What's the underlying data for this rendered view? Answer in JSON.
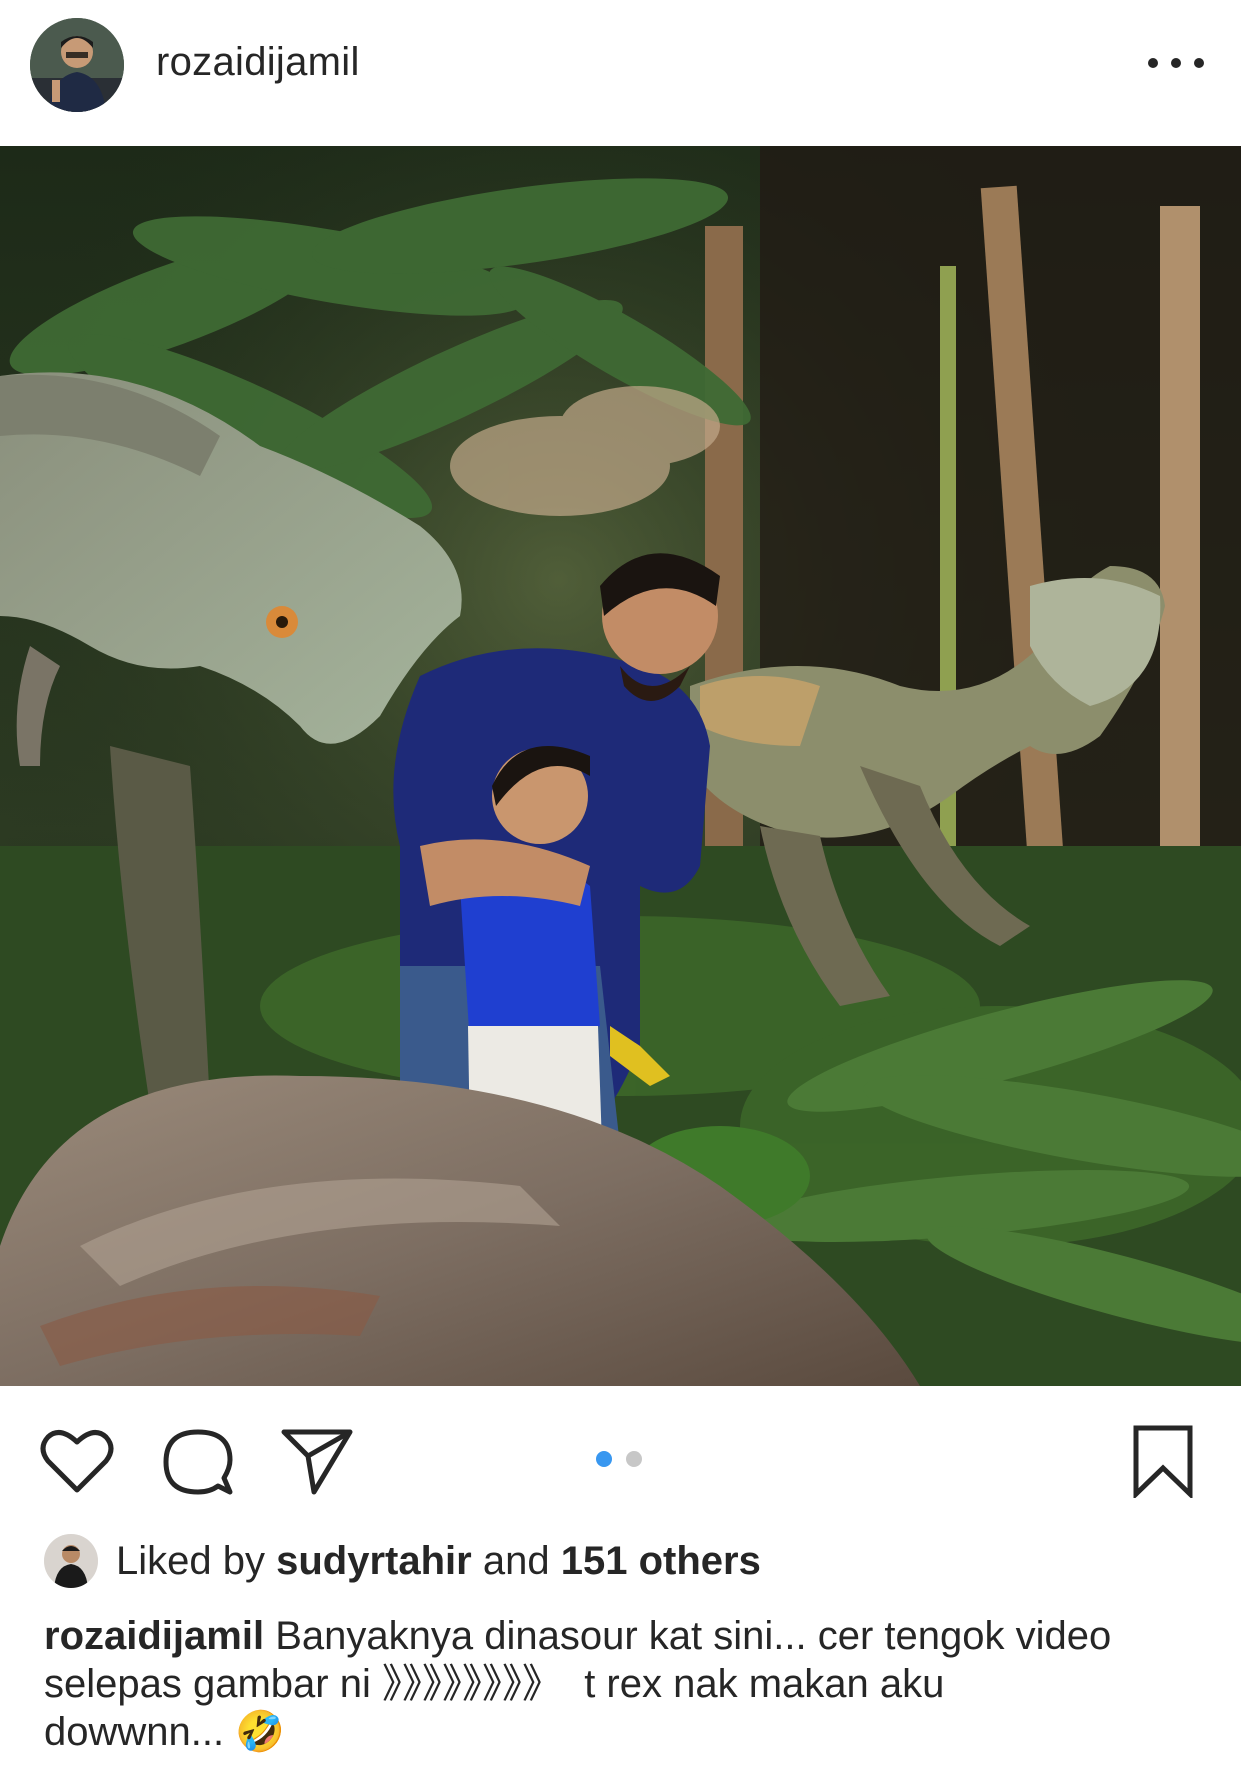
{
  "post": {
    "username": "rozaidijamil",
    "more_icon": "more-horizontal-icon",
    "carousel": {
      "count": 2,
      "active_index": 0,
      "active_color": "#3897f0",
      "inactive_color": "#c7c7c7"
    },
    "likes": {
      "prefix": "Liked by",
      "liker": "sudyrtahir",
      "conjunction": "and",
      "others": "151 others"
    },
    "caption": {
      "author": "rozaidijamil",
      "line1": "Banyaknya dinasour kat sini... cer tengok video",
      "line2": "selepas gambar ni 》》》》》》》》  t rex nak makan aku",
      "line3": "dowwnn... 🤣"
    },
    "icons": [
      "heart-icon",
      "comment-icon",
      "share-icon",
      "bookmark-icon"
    ]
  }
}
